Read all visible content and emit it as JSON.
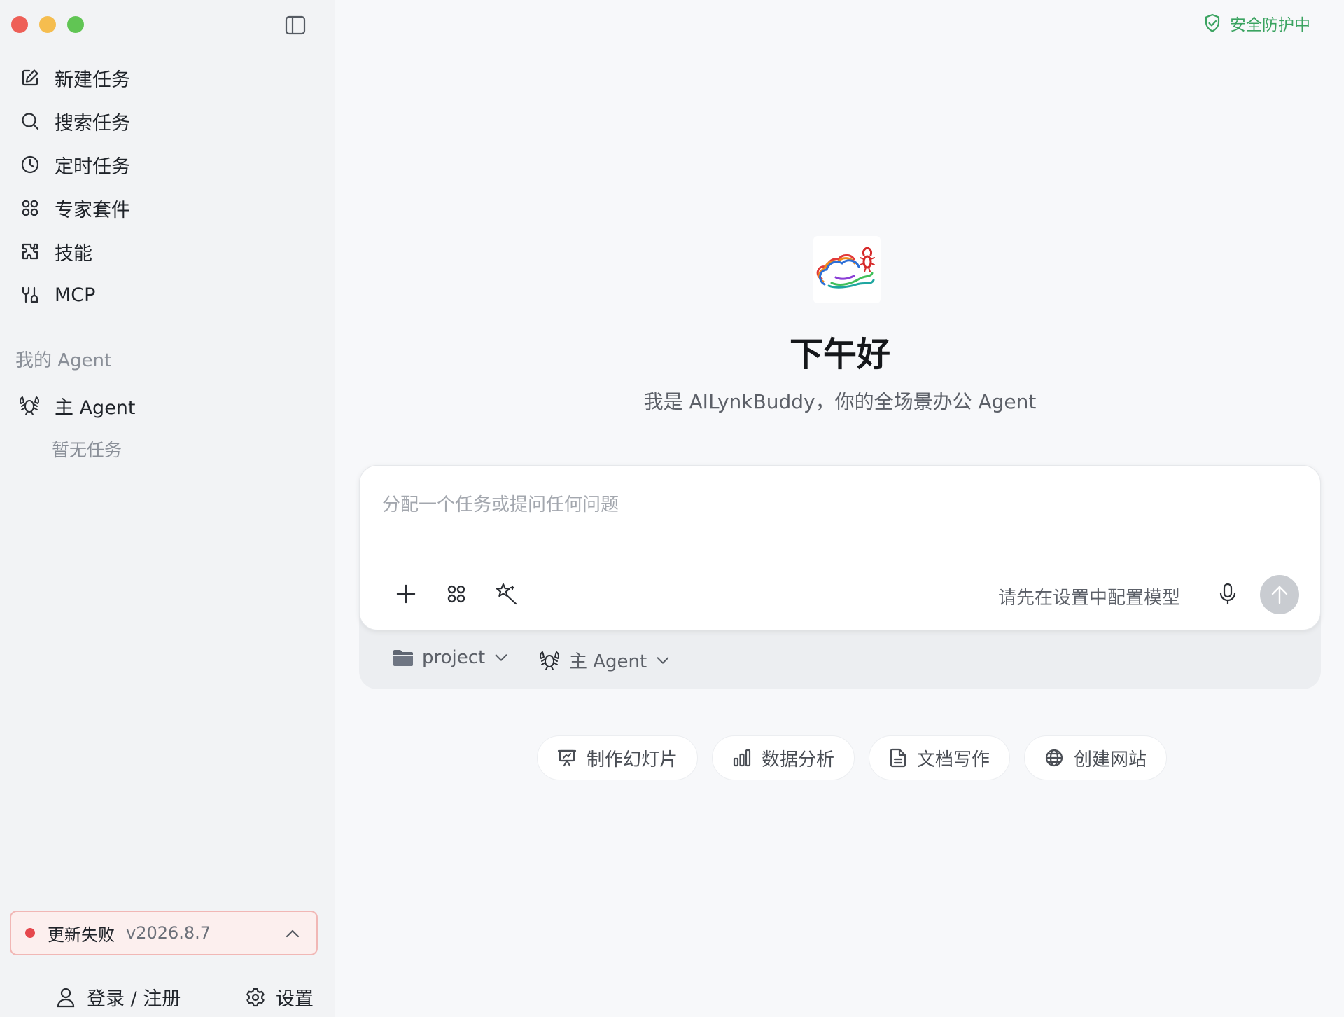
{
  "sidebar": {
    "nav": [
      {
        "label": "新建任务",
        "icon": "edit-icon"
      },
      {
        "label": "搜索任务",
        "icon": "search-icon"
      },
      {
        "label": "定时任务",
        "icon": "clock-icon"
      },
      {
        "label": "专家套件",
        "icon": "grid-icon"
      },
      {
        "label": "技能",
        "icon": "puzzle-icon"
      },
      {
        "label": "MCP",
        "icon": "plug-icon"
      }
    ],
    "section_title": "我的 Agent",
    "agent": {
      "label": "主 Agent",
      "icon": "lobster-icon"
    },
    "empty_tasks": "暂无任务",
    "update": {
      "status": "更新失败",
      "version": "v2026.8.7"
    },
    "login_label": "登录 / 注册",
    "settings_label": "设置"
  },
  "main": {
    "security_label": "安全防护中",
    "greeting": "下午好",
    "subtitle": "我是 AILynkBuddy，你的全场景办公 Agent",
    "composer": {
      "placeholder": "分配一个任务或提问任何问题",
      "model_hint": "请先在设置中配置模型"
    },
    "project_selector": "project",
    "agent_selector": "主 Agent",
    "quick_actions": [
      {
        "label": "制作幻灯片",
        "icon": "presentation-icon"
      },
      {
        "label": "数据分析",
        "icon": "bar-chart-icon"
      },
      {
        "label": "文档写作",
        "icon": "document-icon"
      },
      {
        "label": "创建网站",
        "icon": "globe-icon"
      }
    ]
  },
  "colors": {
    "accent_green": "#3aa360",
    "error_red": "#e5484d",
    "sidebar_bg": "#f2f3f5",
    "main_bg": "#f7f8fa"
  }
}
